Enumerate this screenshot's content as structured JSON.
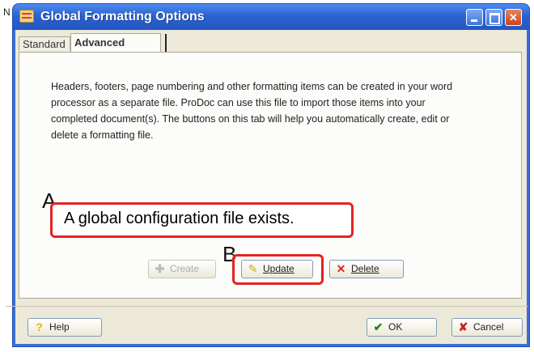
{
  "corner_mark": "N",
  "window": {
    "title": "Global Formatting Options"
  },
  "tabs": [
    {
      "label": "Standard"
    },
    {
      "label": "Advanced"
    }
  ],
  "description": "Headers, footers, page numbering and other formatting items can be created in your word processor as a separate file.  ProDoc can use this file to import those items into your completed document(s).  The buttons on this tab will help you automatically create, edit or delete a formatting file.",
  "annotations": {
    "a": "A",
    "b": "B"
  },
  "status_text": "A global configuration file exists.",
  "buttons": {
    "create": "Create",
    "update": "Update",
    "delete": "Delete",
    "help": "Help",
    "ok": "OK",
    "cancel": "Cancel"
  },
  "icons": {
    "create": "plus-icon",
    "update": "pencil-icon",
    "delete": "x-icon",
    "help": "question-icon",
    "ok": "checkmark-icon",
    "cancel": "x-icon"
  },
  "colors": {
    "titlebar": "#2a62d0",
    "highlight": "#e32424",
    "dialog_bg": "#ece9d8"
  }
}
